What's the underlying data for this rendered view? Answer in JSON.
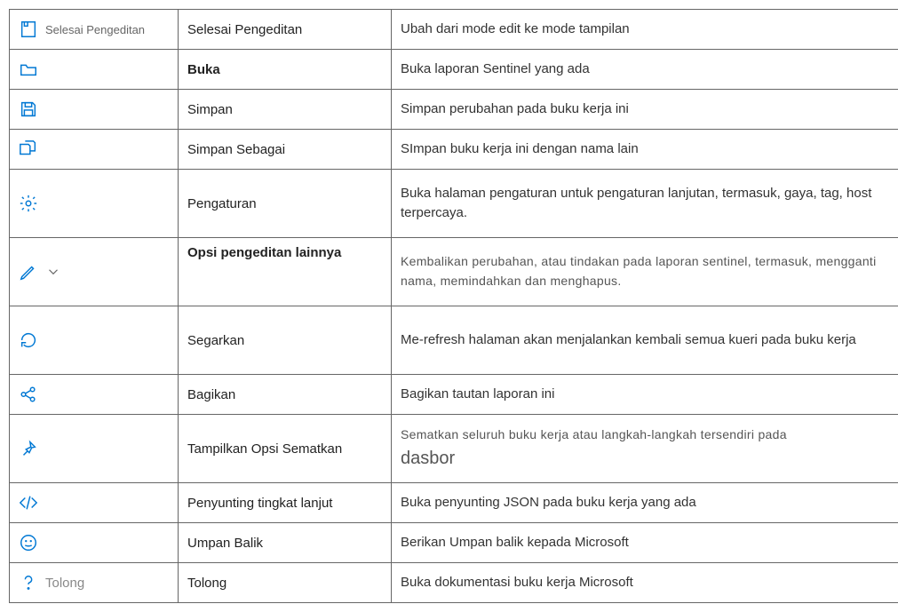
{
  "rows": {
    "done_editing": {
      "icon_label": "Selesai Pengeditan",
      "name": "Selesai Pengeditan",
      "desc": "Ubah dari mode edit ke mode tampilan"
    },
    "open": {
      "name": "Buka",
      "desc": "Buka laporan Sentinel yang ada"
    },
    "save": {
      "name": "Simpan",
      "desc": "Simpan perubahan pada buku kerja ini"
    },
    "save_as": {
      "name": "Simpan Sebagai",
      "desc": "SImpan buku kerja ini dengan nama lain"
    },
    "settings": {
      "name": "Pengaturan",
      "desc": "Buka halaman pengaturan untuk pengaturan lanjutan, termasuk, gaya, tag, host terpercaya."
    },
    "more_edit": {
      "name": "Opsi pengeditan lainnya",
      "desc": "Kembalikan perubahan, atau tindakan pada laporan sentinel, termasuk, mengganti nama, memindahkan dan menghapus."
    },
    "refresh": {
      "name": "Segarkan",
      "desc": "Me-refresh halaman akan menjalankan kembali semua kueri pada buku kerja"
    },
    "share": {
      "name": "Bagikan",
      "desc": "Bagikan tautan laporan ini"
    },
    "pin": {
      "name": "Tampilkan Opsi Sematkan",
      "desc_line1": "Sematkan seluruh buku kerja atau langkah-langkah tersendiri pada",
      "desc_line2": "dasbor"
    },
    "advanced": {
      "name": "Penyunting tingkat lanjut",
      "desc": "Buka penyunting JSON pada buku kerja yang ada"
    },
    "feedback": {
      "name": "Umpan Balik",
      "desc": "Berikan Umpan balik kepada Microsoft"
    },
    "help": {
      "icon_label": "Tolong",
      "name": "Tolong",
      "desc": "Buka dokumentasi buku kerja Microsoft"
    }
  }
}
